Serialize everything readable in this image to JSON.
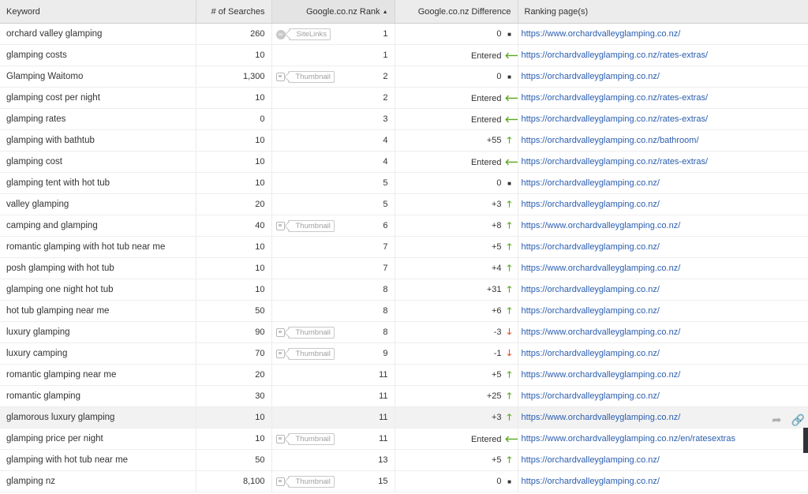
{
  "header": {
    "keyword": "Keyword",
    "searches": "# of Searches",
    "rank": "Google.co.nz Rank",
    "difference": "Google.co.nz Difference",
    "ranking_page": "Ranking page(s)"
  },
  "features": {
    "sitelinks": "SiteLinks",
    "thumbnail": "Thumbnail"
  },
  "rows": [
    {
      "keyword": "orchard valley glamping",
      "searches": "260",
      "feature": "sitelinks",
      "rank": "1",
      "diff": "0",
      "dir": "same",
      "url": "https://www.orchardvalleyglamping.co.nz/"
    },
    {
      "keyword": "glamping costs",
      "searches": "10",
      "feature": "",
      "rank": "1",
      "diff": "Entered",
      "dir": "left",
      "url": "https://orchardvalleyglamping.co.nz/rates-extras/"
    },
    {
      "keyword": "Glamping Waitomo",
      "searches": "1,300",
      "feature": "thumbnail",
      "rank": "2",
      "diff": "0",
      "dir": "same",
      "url": "https://orchardvalleyglamping.co.nz/"
    },
    {
      "keyword": "glamping cost per night",
      "searches": "10",
      "feature": "",
      "rank": "2",
      "diff": "Entered",
      "dir": "left",
      "url": "https://orchardvalleyglamping.co.nz/rates-extras/"
    },
    {
      "keyword": "glamping rates",
      "searches": "0",
      "feature": "",
      "rank": "3",
      "diff": "Entered",
      "dir": "left",
      "url": "https://orchardvalleyglamping.co.nz/rates-extras/"
    },
    {
      "keyword": "glamping with bathtub",
      "searches": "10",
      "feature": "",
      "rank": "4",
      "diff": "+55",
      "dir": "up",
      "url": "https://orchardvalleyglamping.co.nz/bathroom/"
    },
    {
      "keyword": "glamping cost",
      "searches": "10",
      "feature": "",
      "rank": "4",
      "diff": "Entered",
      "dir": "left",
      "url": "https://orchardvalleyglamping.co.nz/rates-extras/"
    },
    {
      "keyword": "glamping tent with hot tub",
      "searches": "10",
      "feature": "",
      "rank": "5",
      "diff": "0",
      "dir": "same",
      "url": "https://orchardvalleyglamping.co.nz/"
    },
    {
      "keyword": "valley glamping",
      "searches": "20",
      "feature": "",
      "rank": "5",
      "diff": "+3",
      "dir": "up",
      "url": "https://orchardvalleyglamping.co.nz/"
    },
    {
      "keyword": "camping and glamping",
      "searches": "40",
      "feature": "thumbnail",
      "rank": "6",
      "diff": "+8",
      "dir": "up",
      "url": "https://www.orchardvalleyglamping.co.nz/"
    },
    {
      "keyword": "romantic glamping with hot tub near me",
      "searches": "10",
      "feature": "",
      "rank": "7",
      "diff": "+5",
      "dir": "up",
      "url": "https://orchardvalleyglamping.co.nz/"
    },
    {
      "keyword": "posh glamping with hot tub",
      "searches": "10",
      "feature": "",
      "rank": "7",
      "diff": "+4",
      "dir": "up",
      "url": "https://www.orchardvalleyglamping.co.nz/"
    },
    {
      "keyword": "glamping one night hot tub",
      "searches": "10",
      "feature": "",
      "rank": "8",
      "diff": "+31",
      "dir": "up",
      "url": "https://orchardvalleyglamping.co.nz/"
    },
    {
      "keyword": "hot tub glamping near me",
      "searches": "50",
      "feature": "",
      "rank": "8",
      "diff": "+6",
      "dir": "up",
      "url": "https://orchardvalleyglamping.co.nz/"
    },
    {
      "keyword": "luxury glamping",
      "searches": "90",
      "feature": "thumbnail",
      "rank": "8",
      "diff": "-3",
      "dir": "down",
      "url": "https://www.orchardvalleyglamping.co.nz/"
    },
    {
      "keyword": "luxury camping",
      "searches": "70",
      "feature": "thumbnail",
      "rank": "9",
      "diff": "-1",
      "dir": "down",
      "url": "https://orchardvalleyglamping.co.nz/"
    },
    {
      "keyword": "romantic glamping near me",
      "searches": "20",
      "feature": "",
      "rank": "11",
      "diff": "+5",
      "dir": "up",
      "url": "https://www.orchardvalleyglamping.co.nz/"
    },
    {
      "keyword": "romantic glamping",
      "searches": "30",
      "feature": "",
      "rank": "11",
      "diff": "+25",
      "dir": "up",
      "url": "https://orchardvalleyglamping.co.nz/"
    },
    {
      "keyword": "glamorous luxury glamping",
      "searches": "10",
      "feature": "",
      "rank": "11",
      "diff": "+3",
      "dir": "up",
      "url": "https://www.orchardvalleyglamping.co.nz/",
      "highlight": true
    },
    {
      "keyword": "glamping price per night",
      "searches": "10",
      "feature": "thumbnail",
      "rank": "11",
      "diff": "Entered",
      "dir": "left",
      "url": "https://www.orchardvalleyglamping.co.nz/en/ratesextras"
    },
    {
      "keyword": "glamping with hot tub near me",
      "searches": "50",
      "feature": "",
      "rank": "13",
      "diff": "+5",
      "dir": "up",
      "url": "https://orchardvalleyglamping.co.nz/"
    },
    {
      "keyword": "glamping nz",
      "searches": "8,100",
      "feature": "thumbnail",
      "rank": "15",
      "diff": "0",
      "dir": "same",
      "url": "https://orchardvalleyglamping.co.nz/"
    }
  ]
}
